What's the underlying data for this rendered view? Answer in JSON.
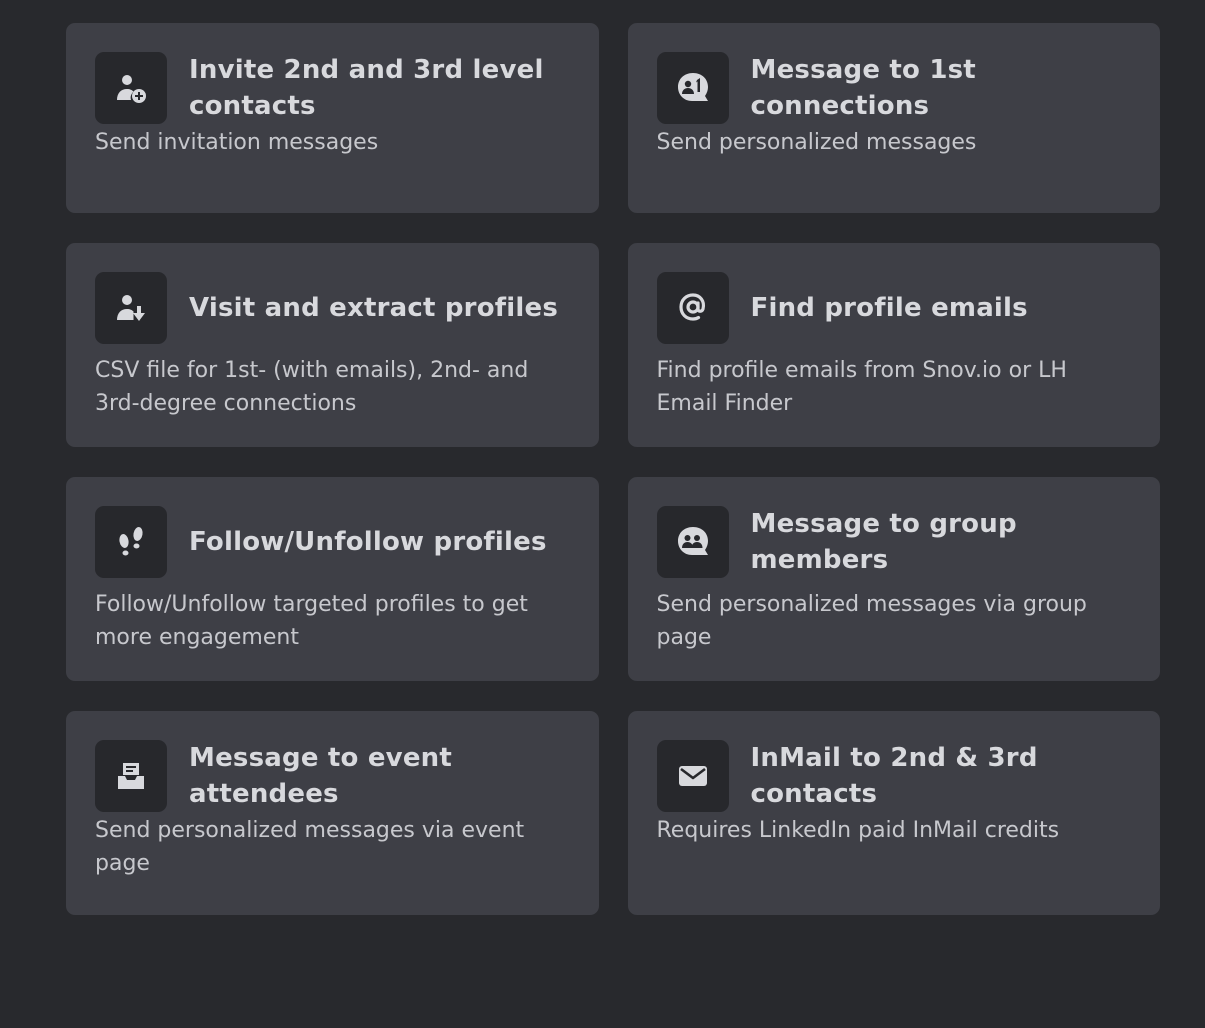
{
  "cards": [
    {
      "title": "Invite 2nd and 3rd level contacts",
      "description": "Send invitation messages",
      "icon": "user-plus-icon"
    },
    {
      "title": "Message to 1st connections",
      "description": "Send personalized messages",
      "icon": "chat-user-1-icon"
    },
    {
      "title": "Visit and extract profiles",
      "description": "CSV file for 1st- (with emails), 2nd- and 3rd-degree connections",
      "icon": "user-download-icon"
    },
    {
      "title": "Find profile emails",
      "description": "Find profile emails from Snov.io or LH Email Finder",
      "icon": "at-sign-icon"
    },
    {
      "title": "Follow/Unfollow profiles",
      "description": "Follow/Unfollow targeted profiles to get more engagement",
      "icon": "footprints-icon"
    },
    {
      "title": "Message to group members",
      "description": "Send personalized messages via group page",
      "icon": "chat-group-icon"
    },
    {
      "title": "Message to event attendees",
      "description": "Send personalized messages via event page",
      "icon": "inbox-icon"
    },
    {
      "title": "InMail to 2nd & 3rd contacts",
      "description": "Requires LinkedIn paid InMail credits",
      "icon": "envelope-icon"
    }
  ]
}
